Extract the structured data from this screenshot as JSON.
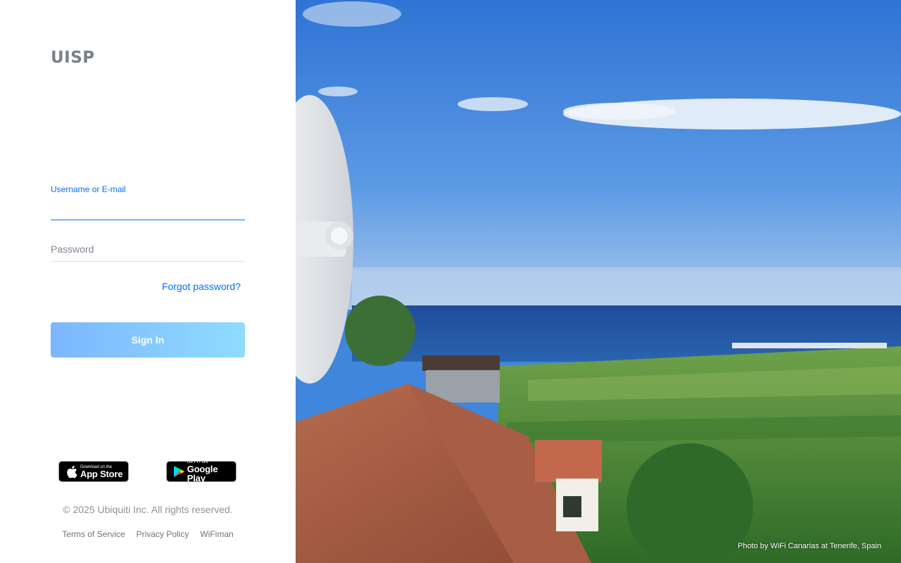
{
  "brand": {
    "logo_text": "UISP"
  },
  "login_form": {
    "username_label": "Username or E-mail",
    "username_value": "",
    "password_placeholder": "Password",
    "forgot_password": "Forgot password?",
    "sign_in": "Sign In"
  },
  "stores": {
    "apple_small": "Download on the",
    "apple_big": "App Store",
    "google_small": "GET IT ON",
    "google_big": "Google Play"
  },
  "footer": {
    "copyright": "© 2025 Ubiquiti Inc. All rights reserved.",
    "links": [
      "Terms of Service",
      "Privacy Policy",
      "WiFiman"
    ]
  },
  "photo": {
    "credit": "Photo by WiFi Canarias at Tenerife, Spain"
  },
  "colors": {
    "accent": "#006fff",
    "sign_in_gradient_start": "#7cb6ff",
    "sign_in_gradient_end": "#8fdcff",
    "logo": "#7b7f89"
  }
}
